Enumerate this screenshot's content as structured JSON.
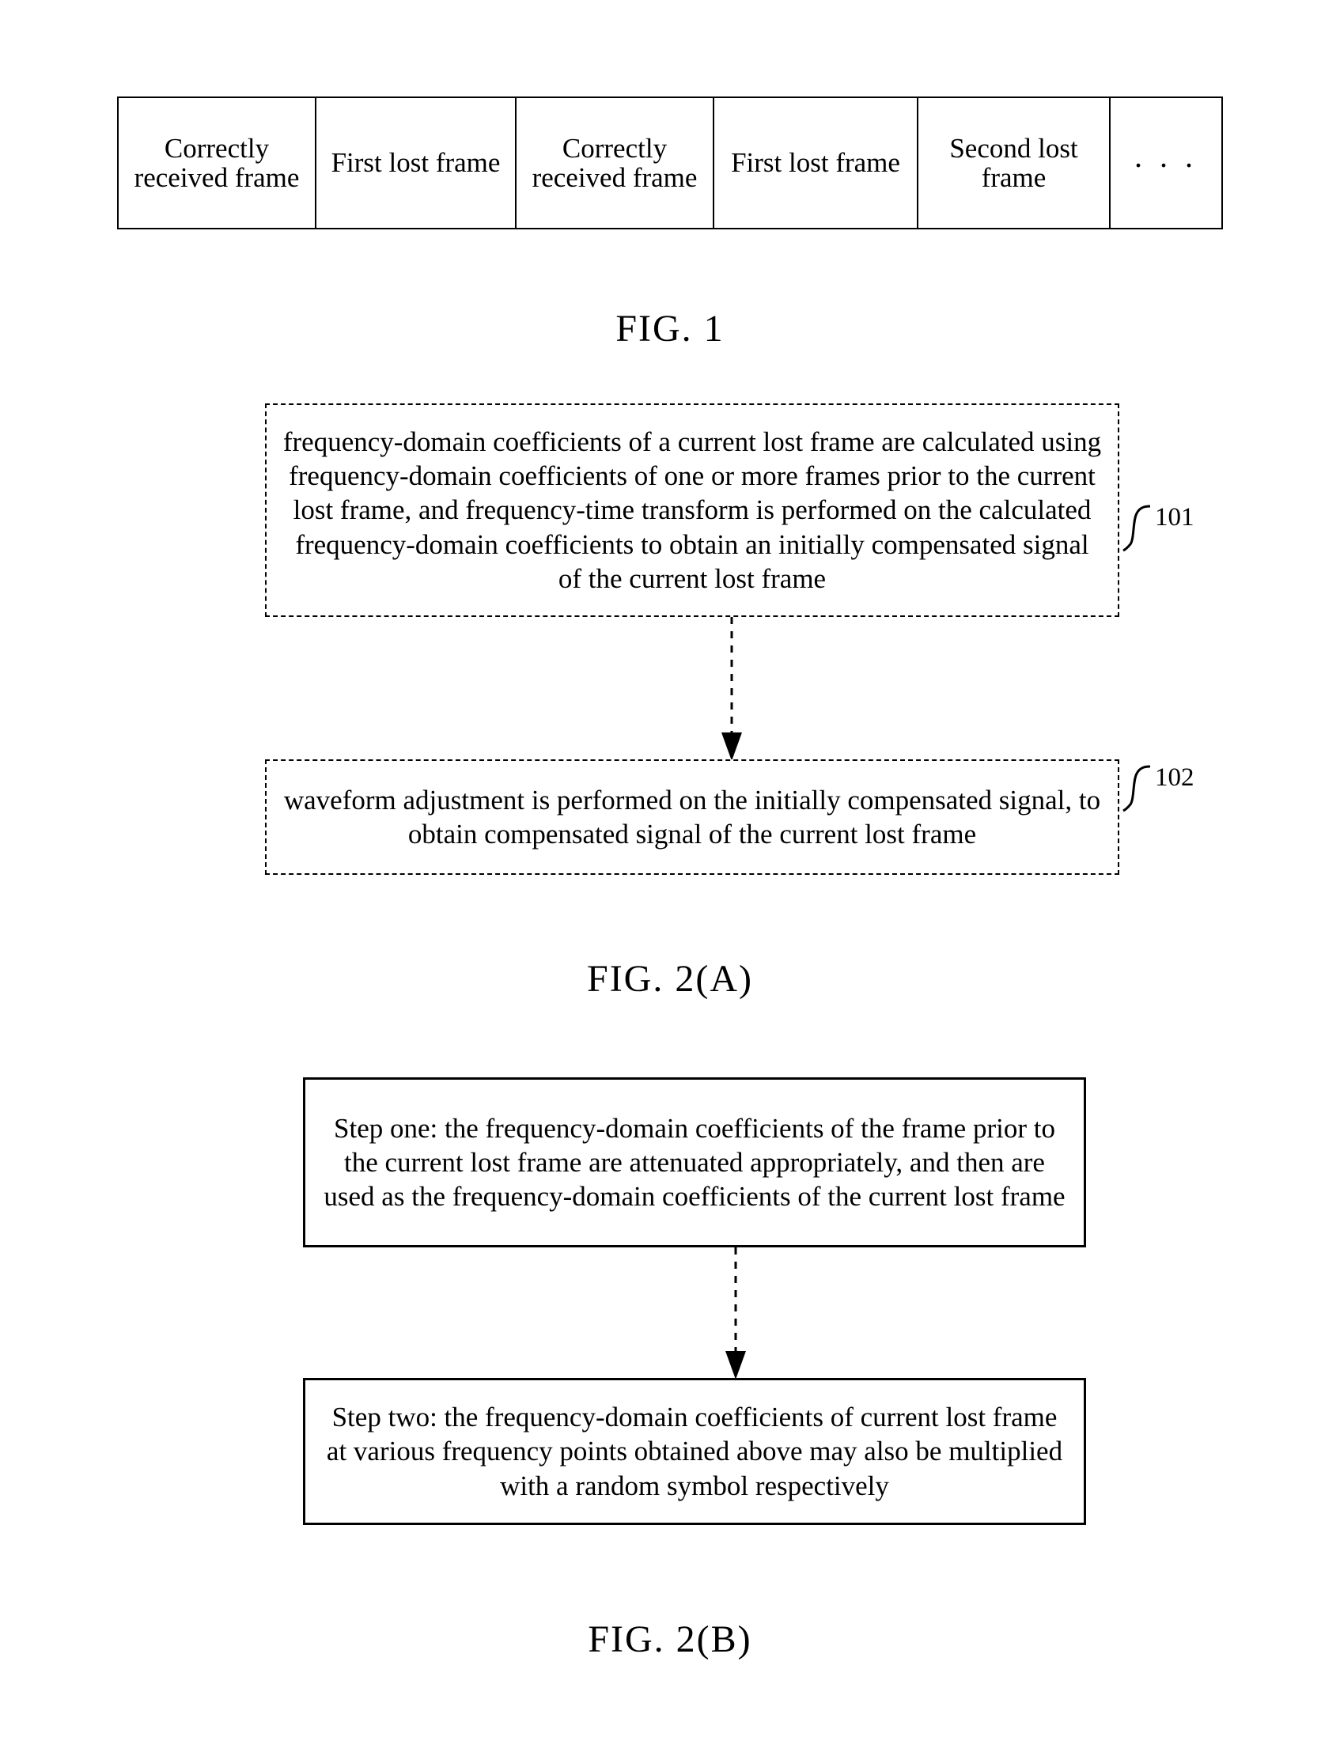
{
  "figures": [
    {
      "id": "fig1",
      "caption": "FIG. 1",
      "type": "frame-sequence-table",
      "cells": [
        "Correctly received frame",
        "First lost frame",
        "Correctly received frame",
        "First lost frame",
        "Second lost frame",
        ". . ."
      ]
    },
    {
      "id": "fig2a",
      "caption": "FIG. 2(A)",
      "type": "flowchart",
      "steps": [
        {
          "ref": "101",
          "text": "frequency-domain coefficients of a current lost frame are calculated using frequency-domain coefficients of one or more frames prior to the current lost frame, and frequency-time transform is performed on the calculated frequency-domain coefficients to obtain an initially compensated signal of the current lost frame"
        },
        {
          "ref": "102",
          "text": "waveform adjustment is performed on the initially compensated signal, to obtain compensated signal of the current lost frame"
        }
      ]
    },
    {
      "id": "fig2b",
      "caption": "FIG. 2(B)",
      "type": "flowchart",
      "steps": [
        {
          "ref": "",
          "text": "Step one: the frequency-domain coefficients of the frame prior to the current lost frame are attenuated appropriately, and then are used as the frequency-domain coefficients of the current lost frame"
        },
        {
          "ref": "",
          "text": "Step two: the frequency-domain coefficients of current lost frame at various frequency points obtained above may also be multiplied with a random symbol respectively"
        }
      ]
    }
  ],
  "fig1": {
    "caption": "FIG. 1",
    "cells": [
      "Correctly received frame",
      "First lost frame",
      "Correctly received frame",
      "First lost frame",
      "Second lost frame",
      ". . ."
    ]
  },
  "fig2a": {
    "caption": "FIG. 2(A)",
    "box101": "frequency-domain coefficients of a current lost frame are calculated using frequency-domain coefficients of one or more frames prior to the current lost frame, and frequency-time transform is performed on the calculated frequency-domain coefficients to obtain an initially compensated signal of the current lost frame",
    "ref101": "101",
    "box102": "waveform adjustment is performed on the initially compensated signal, to obtain compensated signal of the current lost frame",
    "ref102": "102"
  },
  "fig2b": {
    "caption": "FIG. 2(B)",
    "stepOne": "Step one: the frequency-domain coefficients of the frame prior to the current lost frame are attenuated appropriately, and then are used as the frequency-domain coefficients of the current lost frame",
    "stepTwo": "Step two: the frequency-domain coefficients of current lost frame at various frequency points obtained above may also be multiplied with a random symbol respectively"
  },
  "colors": {
    "ink": "#000000",
    "paper": "#ffffff"
  }
}
